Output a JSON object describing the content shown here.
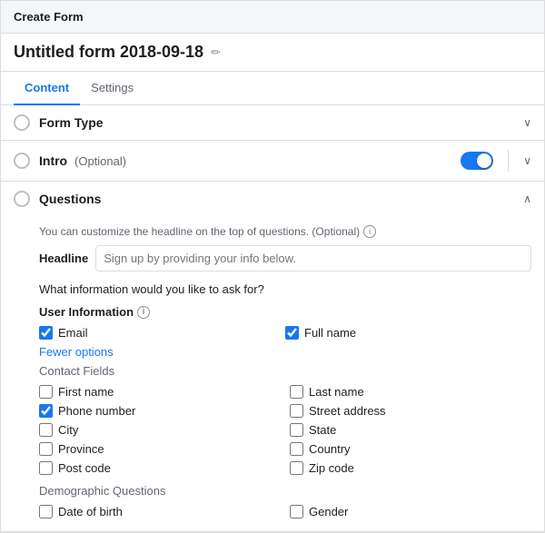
{
  "titleBar": {
    "label": "Create Form"
  },
  "formTitle": {
    "name": "Untitled form 2018-09-18",
    "editIcon": "✏"
  },
  "tabs": [
    {
      "label": "Content",
      "active": true
    },
    {
      "label": "Settings",
      "active": false
    }
  ],
  "sections": {
    "formType": {
      "label": "Form Type",
      "chevron": "∨",
      "expanded": false
    },
    "intro": {
      "label": "Intro",
      "optional": "(Optional)",
      "toggleOn": true,
      "chevron": "∨",
      "expanded": false
    },
    "questions": {
      "label": "Questions",
      "chevron": "∧",
      "expanded": true,
      "hintText": "You can customize the headline on the top of questions. (Optional)",
      "headlineLabel": "Headline",
      "headlinePlaceholder": "Sign up by providing your info below.",
      "askText": "What information would you like to ask for?",
      "userInfoLabel": "User Information",
      "checkboxes": {
        "email": {
          "label": "Email",
          "checked": true
        },
        "fullName": {
          "label": "Full name",
          "checked": true
        }
      },
      "fewerOptions": "Fewer options",
      "contactFields": "Contact Fields",
      "contacts": [
        {
          "label": "First name",
          "checked": false,
          "col": 0
        },
        {
          "label": "Last name",
          "checked": false,
          "col": 1
        },
        {
          "label": "Phone number",
          "checked": true,
          "col": 0
        },
        {
          "label": "Street address",
          "checked": false,
          "col": 1
        },
        {
          "label": "City",
          "checked": false,
          "col": 0
        },
        {
          "label": "State",
          "checked": false,
          "col": 1
        },
        {
          "label": "Province",
          "checked": false,
          "col": 0
        },
        {
          "label": "Country",
          "checked": false,
          "col": 1
        },
        {
          "label": "Post code",
          "checked": false,
          "col": 0
        },
        {
          "label": "Zip code",
          "checked": false,
          "col": 1
        }
      ],
      "demographicLabel": "Demographic Questions",
      "demographics": [
        {
          "label": "Date of birth",
          "checked": false
        },
        {
          "label": "Gender",
          "checked": false
        }
      ]
    }
  }
}
